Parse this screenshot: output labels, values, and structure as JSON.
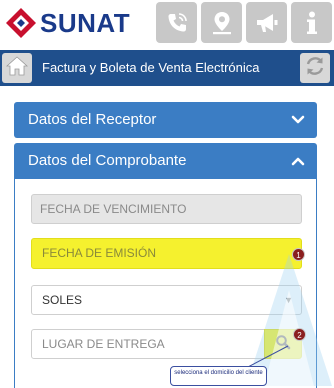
{
  "brand": {
    "name": "SUNAT"
  },
  "header_icons": [
    "phone-icon",
    "location-pin-icon",
    "megaphone-icon",
    "info-icon"
  ],
  "titlebar": {
    "title": "Factura y Boleta de Venta Electrónica",
    "home_icon": "home-icon",
    "refresh_icon": "refresh-icon"
  },
  "panels": {
    "receptor": {
      "label": "Datos del Receptor",
      "state": "collapsed"
    },
    "comprobante": {
      "label": "Datos del Comprobante",
      "state": "expanded"
    }
  },
  "form": {
    "fecha_vencimiento": {
      "placeholder": "FECHA DE VENCIMIENTO",
      "value": ""
    },
    "fecha_emision": {
      "placeholder": "FECHA DE EMISIÓN",
      "value": ""
    },
    "moneda": {
      "selected": "SOLES"
    },
    "lugar_entrega": {
      "placeholder": "LUGAR DE ENTREGA",
      "value": ""
    },
    "search_icon": "search-icon"
  },
  "annotations": {
    "badge_1": "1",
    "badge_2": "2",
    "callout": "selecciona el domicilio del cliente"
  },
  "colors": {
    "brand_blue": "#1a3a8a",
    "brand_red": "#c8102e",
    "titlebar": "#1f4f8c",
    "panel": "#3b7dc4",
    "highlight": "#f5f12e",
    "badge": "#8a1f1f"
  }
}
